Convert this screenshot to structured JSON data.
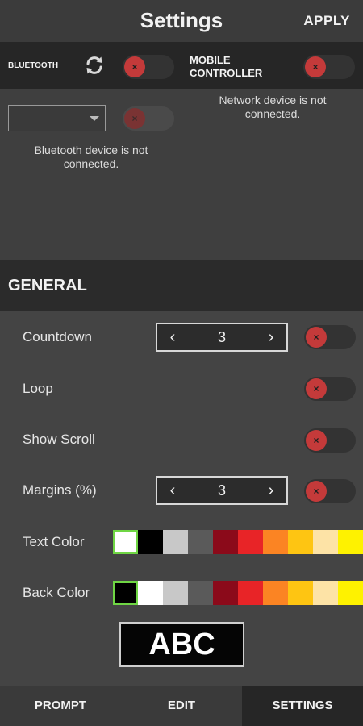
{
  "header": {
    "title": "Settings",
    "apply_label": "APPLY"
  },
  "bluetooth": {
    "label": "BLUETOOTH",
    "icon": "refresh-icon",
    "toggle_on": false,
    "select_value": "",
    "status": "Bluetooth device is not connected."
  },
  "mobile_controller": {
    "label_line1": "MOBILE",
    "label_line2": "CONTROLLER",
    "toggle_on": false,
    "status": "Network device is not connected."
  },
  "general": {
    "title": "GENERAL",
    "countdown": {
      "label": "Countdown",
      "value": "3",
      "prev": "‹",
      "next": "›",
      "enabled": false
    },
    "loop": {
      "label": "Loop",
      "enabled": false
    },
    "show_scroll": {
      "label": "Show Scroll",
      "enabled": false
    },
    "margins": {
      "label": "Margins (%)",
      "value": "3",
      "prev": "‹",
      "next": "›",
      "enabled": false
    },
    "text_color": {
      "label": "Text Color",
      "selected_index": 0
    },
    "back_color": {
      "label": "Back Color",
      "selected_index": 0
    }
  },
  "palettes": {
    "text_colors": [
      "#ffffff",
      "#000000",
      "#c8c8c8",
      "#5a5a5a",
      "#8b0a1a",
      "#e82427",
      "#fb8423",
      "#fec512",
      "#fde3a6",
      "#fef200"
    ],
    "back_colors": [
      "#000000",
      "#ffffff",
      "#c8c8c8",
      "#5a5a5a",
      "#8b0a1a",
      "#e82427",
      "#fb8423",
      "#fec512",
      "#fde3a6",
      "#fef200"
    ]
  },
  "preview": {
    "text": "ABC"
  },
  "tabs": [
    {
      "label": "PROMPT",
      "active": false
    },
    {
      "label": "EDIT",
      "active": false
    },
    {
      "label": "SETTINGS",
      "active": true
    }
  ],
  "colors": {
    "accent_selected": "#6fd644",
    "toggle_off": "#c43a3a"
  }
}
